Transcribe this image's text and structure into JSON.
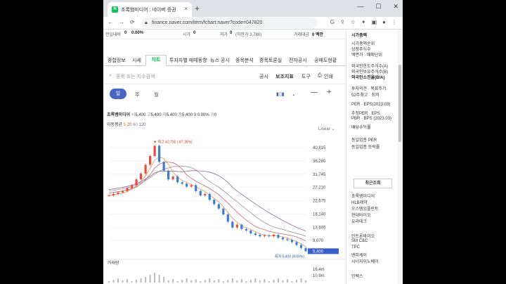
{
  "browser": {
    "tab_title": "초록뱀미디어 : 네이버 증권",
    "url": "finance.naver.com/item/fchart.naver?code=047820",
    "new_tab": "+",
    "close": "×",
    "win_min": "—",
    "win_max": "☐",
    "win_close": "✕"
  },
  "topinfo": {
    "prev_label": "전일대비",
    "prev_value": "0",
    "prev_pct": "0.00%",
    "open_label": "시가",
    "open_value": "0",
    "low_label": "저가",
    "low_value": "0",
    "low_note": "(하한가 3,780)",
    "trade_amt_label": "거래대금",
    "trade_amt_value": "0 백만"
  },
  "tabs": [
    "종합정보",
    "시세",
    "차트",
    "투자자별 매매동향",
    "뉴스 공시",
    "종목분석",
    "종목토론실",
    "전자공시",
    "공매도현황"
  ],
  "search": {
    "placeholder": "종목 또는 지수검색",
    "disclosure": "공시",
    "indicator": "보조지표",
    "tools": "도구",
    "print": "인쇄"
  },
  "periods": [
    "일",
    "주",
    "월"
  ],
  "pricebar": {
    "name": "초록뱀미디어",
    "o_label": "시",
    "o_value": "5,400",
    "h_label": "고",
    "h_value": "5,400",
    "l_label": "저",
    "l_value": "5,400",
    "c_label": "종",
    "c_value": "5,400",
    "chg": "0",
    "chg_pct": "0.00%",
    "vol_label": "거",
    "vol_value": "0"
  },
  "ma": {
    "label": "이동평균",
    "m5": "5",
    "m20": "20",
    "m60": "60",
    "m120": "120"
  },
  "scale_label": "Linear",
  "chart_data": {
    "type": "line",
    "title": "",
    "series": [
      {
        "name": "",
        "values": [
          24500,
          25000,
          25500,
          26000,
          27000,
          28000,
          30000,
          32000,
          35000,
          38000,
          41500,
          36000,
          33000,
          30000,
          31000,
          29000,
          28500,
          27500,
          28000,
          26000,
          24500,
          25000,
          23000,
          21500,
          20000,
          18000,
          15500,
          13500,
          14500,
          13000,
          12500,
          11500,
          11000,
          10500,
          10800,
          10500,
          11000,
          10000,
          9500,
          9200,
          8500,
          7500,
          6500,
          5400
        ]
      }
    ],
    "yticks": [
      "40,815",
      "36,280",
      "31,745",
      "27,210",
      "22,675",
      "18,140",
      "13,605",
      "9,070"
    ],
    "ylim": [
      5000,
      44000
    ],
    "high_label": "최고 42,700 (-87.35%)",
    "low_label": "최저 5,400 (0.00%)",
    "last_value": "5,400",
    "volume_label": "거래량",
    "volume_ticks": [
      "16.4m",
      "10.9m"
    ],
    "grid": true
  },
  "right_panel": {
    "items": [
      {
        "text": "시가총액",
        "bold": true
      },
      {
        "text": "시가총액순위"
      },
      {
        "text": "상장주식수"
      },
      {
        "text": "액면가 · 매매단위"
      },
      {
        "text": "외국인한도주식수(A)"
      },
      {
        "text": "외국인보유주식수(B)"
      },
      {
        "text": "외국인소진율(B/A)",
        "bold": true
      },
      {
        "text": "투자의견 · 목표주가"
      },
      {
        "text": "52주최고 · 최저"
      },
      {
        "text": "PER · EPS(2023.03)"
      },
      {
        "text": "추정PER · EPS"
      },
      {
        "text": "PBR · BPS (2023.03)"
      },
      {
        "text": "배당수익률"
      },
      {
        "text": "동일업종 PER"
      },
      {
        "text": "동일업종 등락률"
      }
    ],
    "recent_button": "최근조회",
    "recent": [
      "초록뱀미디어",
      "HLB제약",
      "오스템임플란트",
      "현대바이오",
      "유라테크",
      "인트론바이오",
      "SM C&C",
      "TPC",
      "엔피케이",
      "시너지이노베이",
      "인팩스"
    ]
  }
}
